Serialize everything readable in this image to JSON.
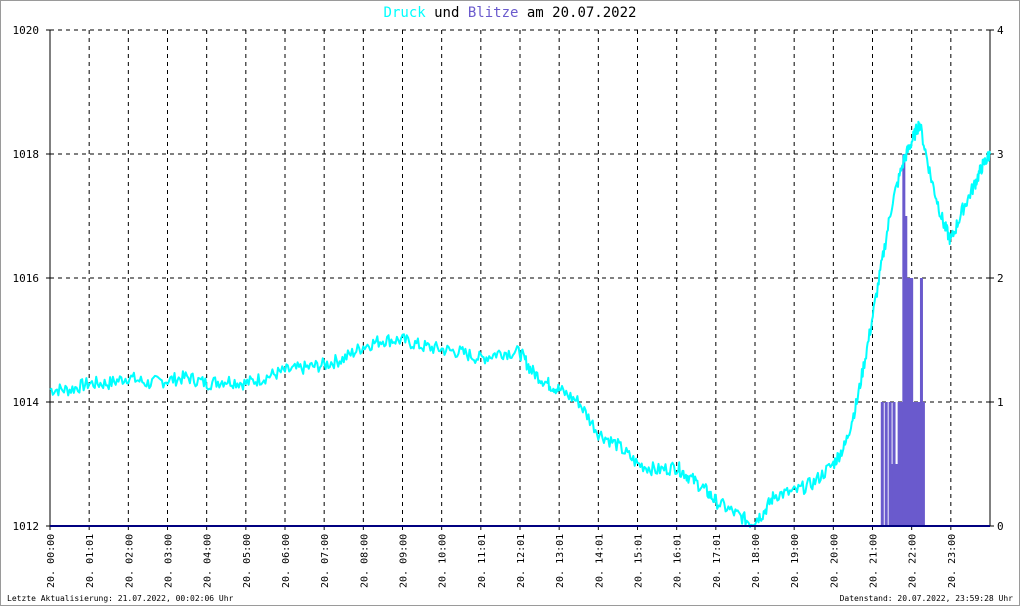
{
  "header": {
    "title_parts": [
      {
        "text": "Druck",
        "color": "#00ffff"
      },
      {
        "text": " und ",
        "color": "#000000"
      },
      {
        "text": "Blitze",
        "color": "#6a5acd"
      },
      {
        "text": " am 20.07.2022",
        "color": "#000000"
      }
    ]
  },
  "footer": {
    "left": "Letzte Aktualisierung: 21.07.2022, 00:02:06 Uhr",
    "right": "Datenstand: 20.07.2022, 23:59:28 Uhr"
  },
  "colors": {
    "pressure": "#00ffff",
    "lightning": "#6a5acd",
    "zero_line": "#000080",
    "grid": "#000000",
    "axis": "#000000"
  },
  "chart_data": {
    "type": "line",
    "grid": true,
    "x_tick_labels": [
      "20. 00:00",
      "20. 01:01",
      "20. 02:00",
      "20. 03:00",
      "20. 04:00",
      "20. 05:00",
      "20. 06:00",
      "20. 07:00",
      "20. 08:00",
      "20. 09:00",
      "20. 10:00",
      "20. 11:01",
      "20. 12:01",
      "20. 13:01",
      "20. 14:01",
      "20. 15:01",
      "20. 16:01",
      "20. 17:01",
      "20. 18:00",
      "20. 19:00",
      "20. 20:00",
      "20. 21:00",
      "20. 22:00",
      "20. 23:00"
    ],
    "y_left": {
      "min": 1012,
      "max": 1020,
      "ticks": [
        1012,
        1014,
        1016,
        1018,
        1020
      ]
    },
    "y_right": {
      "min": 0,
      "max": 4,
      "ticks": [
        0,
        1,
        2,
        3,
        4
      ]
    },
    "x_range_hours": [
      0,
      24
    ],
    "series": [
      {
        "name": "Druck",
        "axis": "left",
        "x_hours": [
          0.0,
          0.5,
          1.0,
          1.5,
          2.0,
          2.5,
          3.0,
          3.5,
          4.0,
          4.5,
          5.0,
          5.5,
          6.0,
          6.5,
          7.0,
          7.5,
          8.0,
          8.5,
          9.0,
          9.5,
          10.0,
          10.5,
          11.0,
          11.5,
          12.0,
          12.3,
          12.7,
          13.0,
          13.5,
          14.0,
          14.5,
          15.0,
          15.5,
          16.0,
          16.3,
          16.7,
          17.0,
          17.5,
          17.9,
          18.2,
          18.5,
          19.0,
          19.5,
          20.0,
          20.3,
          20.6,
          20.9,
          21.2,
          21.5,
          21.8,
          22.0,
          22.2,
          22.5,
          22.8,
          23.0,
          23.3,
          23.6,
          23.8,
          24.0
        ],
        "values": [
          1014.2,
          1014.2,
          1014.3,
          1014.3,
          1014.4,
          1014.3,
          1014.35,
          1014.4,
          1014.3,
          1014.35,
          1014.3,
          1014.4,
          1014.5,
          1014.55,
          1014.6,
          1014.7,
          1014.9,
          1015.0,
          1015.0,
          1014.9,
          1014.85,
          1014.8,
          1014.7,
          1014.8,
          1014.8,
          1014.5,
          1014.3,
          1014.2,
          1014.0,
          1013.5,
          1013.3,
          1013.0,
          1012.9,
          1012.95,
          1012.8,
          1012.6,
          1012.4,
          1012.2,
          1012.05,
          1012.2,
          1012.5,
          1012.55,
          1012.7,
          1013.0,
          1013.3,
          1014.0,
          1015.0,
          1016.1,
          1017.2,
          1017.9,
          1018.2,
          1018.5,
          1017.6,
          1016.9,
          1016.6,
          1017.1,
          1017.5,
          1017.8,
          1018.0
        ]
      },
      {
        "name": "Blitze",
        "axis": "right",
        "type": "bar",
        "bars": [
          {
            "x_hours": 21.25,
            "value": 1
          },
          {
            "x_hours": 21.35,
            "value": 1
          },
          {
            "x_hours": 21.45,
            "value": 1
          },
          {
            "x_hours": 21.5,
            "value": 0.5
          },
          {
            "x_hours": 21.55,
            "value": 1
          },
          {
            "x_hours": 21.62,
            "value": 0.5
          },
          {
            "x_hours": 21.68,
            "value": 1
          },
          {
            "x_hours": 21.75,
            "value": 1
          },
          {
            "x_hours": 21.8,
            "value": 3
          },
          {
            "x_hours": 21.85,
            "value": 2.5
          },
          {
            "x_hours": 21.9,
            "value": 2
          },
          {
            "x_hours": 21.95,
            "value": 2
          },
          {
            "x_hours": 22.0,
            "value": 2
          },
          {
            "x_hours": 22.05,
            "value": 1
          },
          {
            "x_hours": 22.1,
            "value": 1
          },
          {
            "x_hours": 22.15,
            "value": 1
          },
          {
            "x_hours": 22.2,
            "value": 1
          },
          {
            "x_hours": 22.25,
            "value": 2
          },
          {
            "x_hours": 22.3,
            "value": 1
          }
        ]
      }
    ]
  }
}
